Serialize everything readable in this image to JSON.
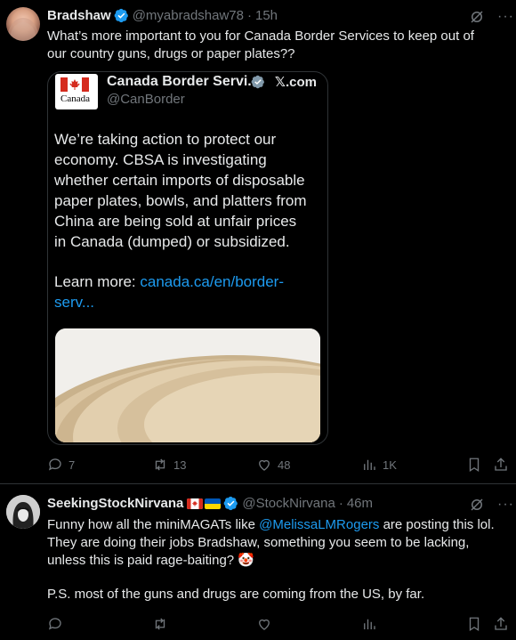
{
  "post1": {
    "author_name": "Bradshaw",
    "author_handle": "@myabradshaw78",
    "separator": "·",
    "time": "15h",
    "text": "What’s more important to you for Canada Border Services to keep out of our country guns, drugs or paper plates??",
    "quote": {
      "name": "Canada Border Servi...",
      "handle": "@CanBorder",
      "source": "𝕏.com",
      "logo_text": "Canada",
      "text": "We’re taking action to protect our economy. CBSA is investigating whether certain imports of disposable paper plates, bowls, and platters from China are being sold at unfair prices in Canada (dumped) or subsidized.",
      "learn_prefix": "Learn more: ",
      "learn_link": "canada.ca/en/border-serv..."
    },
    "actions": {
      "replies": "7",
      "reposts": "13",
      "likes": "48",
      "views": "1K"
    }
  },
  "post2": {
    "author_name": "SeekingStockNirvana",
    "author_handle": "@StockNirvana",
    "separator": "·",
    "time": "46m",
    "text_part1": "Funny how all the miniMAGATs like ",
    "mention": "@MelissaLMRogers",
    "text_part2": " are posting this lol. They are doing their jobs Bradshaw, something you seem to be lacking, unless this is paid rage-baiting? 🤡",
    "text_ps": "P.S. most of the guns and drugs are coming from the US, by far."
  },
  "colors": {
    "background": "#000000",
    "text": "#e7e9ea",
    "muted": "#71767b",
    "link": "#1d9bf0",
    "border": "#2f3336"
  }
}
